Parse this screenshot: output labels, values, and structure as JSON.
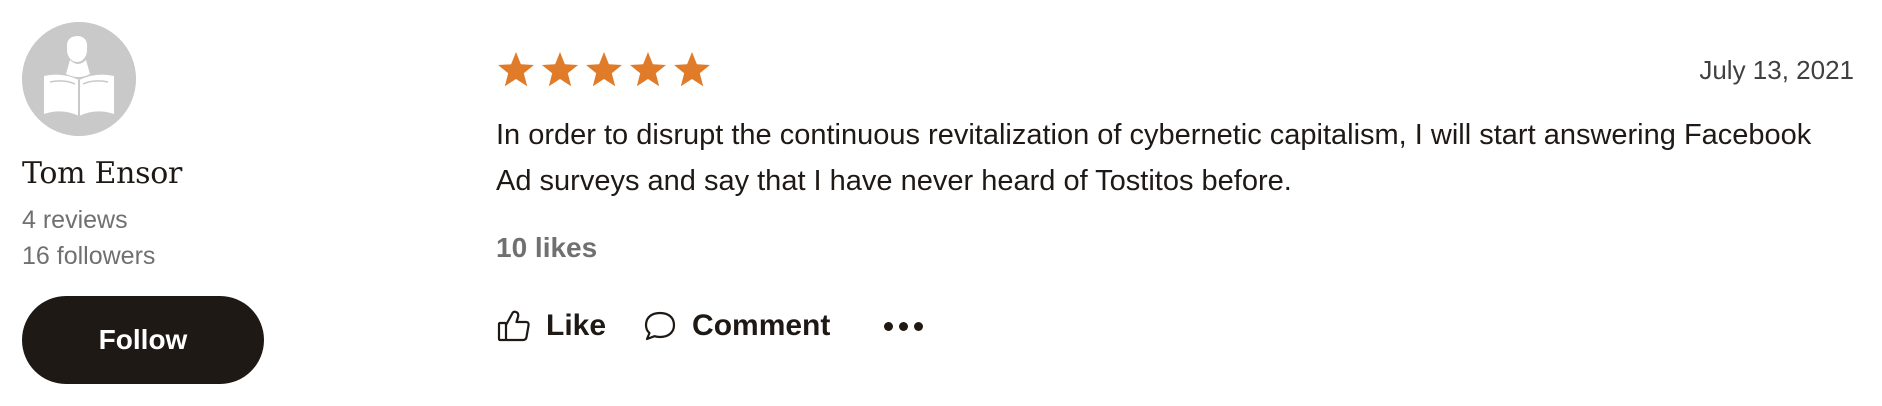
{
  "reviewer": {
    "name": "Tom Ensor",
    "reviews": "4 reviews",
    "followers": "16 followers",
    "follow_label": "Follow",
    "avatar_icon": "reader-silhouette-icon"
  },
  "review": {
    "rating": 5,
    "rating_max": 5,
    "star_color": "#e07b2a",
    "date": "July 13, 2021",
    "text": "In order to disrupt the continuous revitalization of cybernetic capitalism, I will start answering Facebook Ad surveys and say that I have never heard of Tostitos before.",
    "likes": "10 likes"
  },
  "actions": {
    "like_label": "Like",
    "like_icon": "thumbs-up-icon",
    "comment_label": "Comment",
    "comment_icon": "speech-bubble-icon",
    "more_icon": "more-options-icon"
  },
  "colors": {
    "primary_text": "#1e1915",
    "secondary_text": "#707070",
    "button_bg": "#1e1915",
    "button_text": "#ffffff",
    "avatar_bg": "#c9c9c9"
  }
}
